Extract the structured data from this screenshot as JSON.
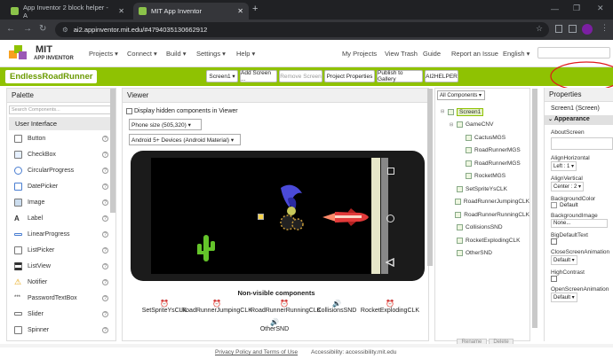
{
  "browser": {
    "tabs": [
      {
        "label": "App Inventor 2 block helper - A"
      },
      {
        "label": "MIT App Inventor"
      }
    ],
    "url": "ai2.appinventor.mit.edu/#4794035130662912"
  },
  "header": {
    "logo_line1": "MIT",
    "logo_line2": "APP INVENTOR",
    "menus": [
      "Projects ▾",
      "Connect ▾",
      "Build ▾",
      "Settings ▾",
      "Help ▾"
    ],
    "links": [
      "My Projects",
      "View Trash",
      "Guide",
      "Report an Issue",
      "English ▾"
    ]
  },
  "project": {
    "name": "EndlessRoadRunner",
    "screen_select": "Screen1 ▾",
    "buttons": [
      "Add Screen ...",
      "Remove Screen",
      "Project Properties",
      "Publish to Gallery",
      "AI2HELPER"
    ]
  },
  "palette": {
    "title": "Palette",
    "search_placeholder": "Search Components...",
    "category": "User Interface",
    "items": [
      "Button",
      "CheckBox",
      "CircularProgress",
      "DatePicker",
      "Image",
      "Label",
      "LinearProgress",
      "ListPicker",
      "ListView",
      "Notifier",
      "PasswordTextBox",
      "Slider",
      "Spinner"
    ]
  },
  "viewer": {
    "title": "Viewer",
    "checkbox_label": "Display hidden components in Viewer",
    "size_select": "Phone size (505,320) ▾",
    "device_select": "Android 5+ Devices (Android Material) ▾",
    "nonvisible_title": "Non-visible components",
    "nonvisible": [
      "SetSpriteYsCLK",
      "RoadRunnerJumpingCLK",
      "RoadRunnerRunningCLK",
      "CollisionsSND",
      "RocketExplodingCLK",
      "OtherSND"
    ]
  },
  "components": {
    "select": "All Components ▾",
    "tree": [
      {
        "label": "Screen1",
        "level": 0
      },
      {
        "label": "GameCNV",
        "level": 1
      },
      {
        "label": "CactusMGS",
        "level": 2
      },
      {
        "label": "RoadRunnerMGS",
        "level": 2
      },
      {
        "label": "RoadRunnerMGS",
        "level": 2
      },
      {
        "label": "RocketMGS",
        "level": 2
      },
      {
        "label": "SetSpriteYsCLK",
        "level": 1
      },
      {
        "label": "RoadRunnerJumpingCLK",
        "level": 1
      },
      {
        "label": "RoadRunnerRunningCLK",
        "level": 1
      },
      {
        "label": "CollisionsSND",
        "level": 1
      },
      {
        "label": "RocketExplodingCLK",
        "level": 1
      },
      {
        "label": "OtherSND",
        "level": 1
      }
    ],
    "rename": "Rename",
    "delete": "Delete"
  },
  "properties": {
    "title": "Properties",
    "screen": "Screen1 (Screen)",
    "section": "Appearance",
    "rows": [
      {
        "label": "AboutScreen",
        "value": ""
      },
      {
        "label": "AlignHorizontal",
        "value": "Left : 1 ▾"
      },
      {
        "label": "AlignVertical",
        "value": "Center : 2 ▾"
      },
      {
        "label": "BackgroundColor",
        "value": "Default"
      },
      {
        "label": "BackgroundImage",
        "value": "None..."
      },
      {
        "label": "BigDefaultText",
        "value": ""
      },
      {
        "label": "CloseScreenAnimation",
        "value": "Default ▾"
      },
      {
        "label": "HighContrast",
        "value": ""
      },
      {
        "label": "OpenScreenAnimation",
        "value": "Default ▾"
      }
    ]
  },
  "footer": {
    "privacy": "Privacy Policy and Terms of Use",
    "accessibility": "Accessibility: accessibility.mit.edu"
  },
  "colors": {
    "brand_green": "#8fc202",
    "annotation_red": "#e0181b"
  }
}
